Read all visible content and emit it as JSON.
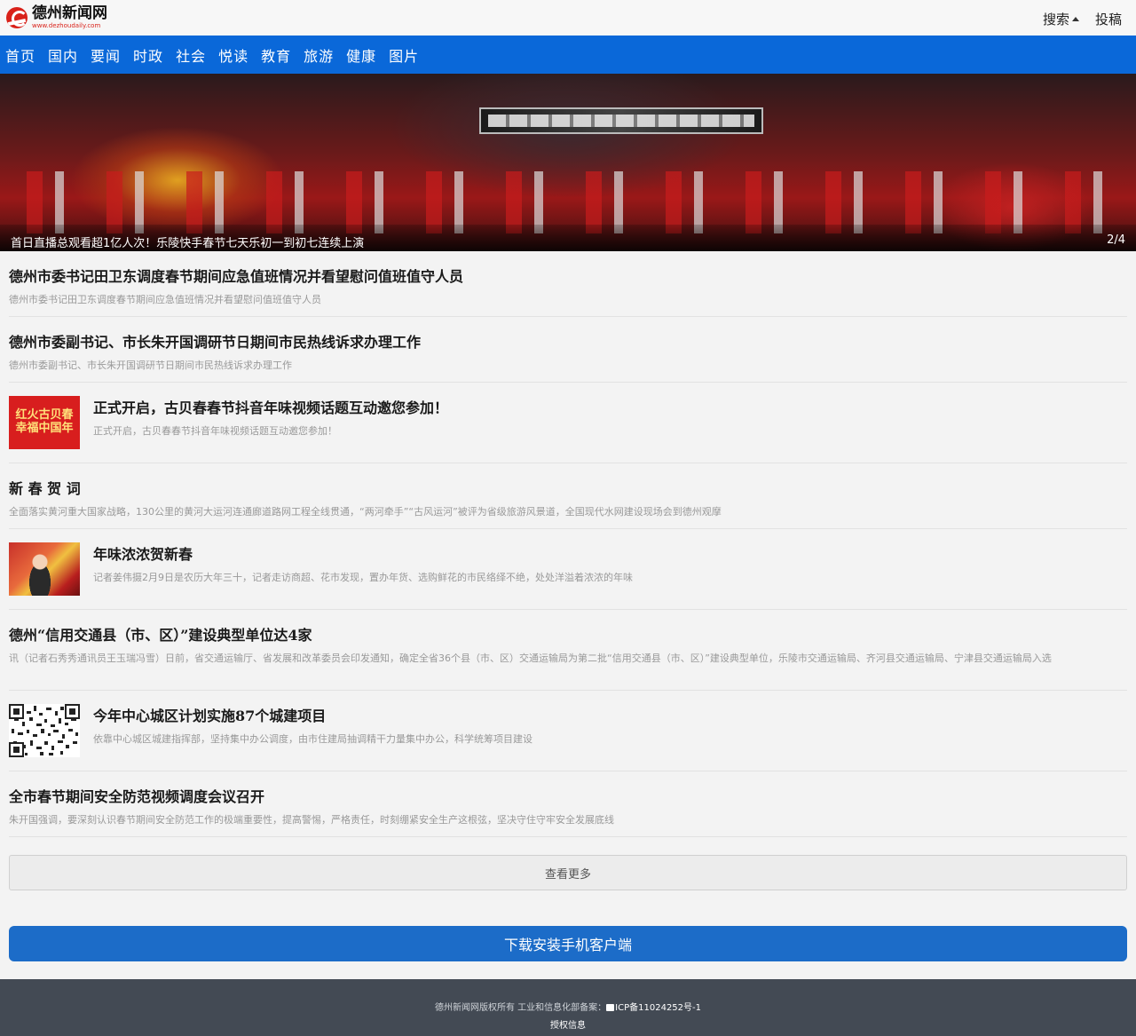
{
  "header": {
    "logo_name": "德州新闻网",
    "logo_url": "www.dezhoudaily.com",
    "search_label": "搜索",
    "submit_label": "投稿"
  },
  "nav": {
    "items": [
      "首页",
      "国内",
      "要闻",
      "时政",
      "社会",
      "悦读",
      "教育",
      "旅游",
      "健康",
      "图片"
    ]
  },
  "banner": {
    "caption": "首日直播总观看超1亿人次！乐陵快手春节七天乐初一到初七连续上演",
    "counter": "2/4"
  },
  "news": [
    {
      "title": "德州市委书记田卫东调度春节期间应急值班情况并看望慰问值班值守人员",
      "summary": "德州市委书记田卫东调度春节期间应急值班情况并看望慰问值班值守人员",
      "thumb": null
    },
    {
      "title": "德州市委副书记、市长朱开国调研节日期间市民热线诉求办理工作",
      "summary": "德州市委副书记、市长朱开国调研节日期间市民热线诉求办理工作",
      "thumb": null
    },
    {
      "title": "正式开启，古贝春春节抖音年味视频话题互动邀您参加！",
      "summary": "正式开启，古贝春春节抖音年味视频话题互动邀您参加！",
      "thumb": "red-poster",
      "thumb_text": [
        "红火古贝春",
        "幸福中国年"
      ]
    },
    {
      "title": "新 春 贺 词",
      "summary": "全面落实黄河重大国家战略，130公里的黄河大运河连通廊道路网工程全线贯通，“两河牵手”“古风运河”被评为省级旅游风景道，全国现代水网建设现场会到德州观摩",
      "thumb": null
    },
    {
      "title": "年味浓浓贺新春",
      "summary": "记者姜伟摄2月9日是农历大年三十，记者走访商超、花市发现，置办年货、选购鲜花的市民络绎不绝，处处洋溢着浓浓的年味",
      "thumb": "photo"
    },
    {
      "title": "德州“信用交通县（市、区）”建设典型单位达4家",
      "summary": "讯（记者石秀秀通讯员王玉瑞冯雪）日前，省交通运输厅、省发展和改革委员会印发通知，确定全省36个县（市、区）交通运输局为第二批“信用交通县（市、区）”建设典型单位，乐陵市交通运输局、齐河县交通运输局、宁津县交通运输局入选",
      "thumb": null
    },
    {
      "title": "今年中心城区计划实施87个城建项目",
      "summary": "依靠中心城区城建指挥部，坚持集中办公调度，由市住建局抽调精干力量集中办公，科学统筹项目建设",
      "thumb": "qr"
    },
    {
      "title": "全市春节期间安全防范视频调度会议召开",
      "summary": "朱开国强调，要深刻认识春节期间安全防范工作的极端重要性，提高警惕，严格责任，时刻绷紧安全生产这根弦，坚决守住守牢安全发展底线",
      "thumb": null
    }
  ],
  "more_label": "查看更多",
  "download_label": "下载安装手机客户端",
  "footer": {
    "copyright": "德州新闻网版权所有 工业和信息化部备案：",
    "icp": "ICP备11024252号-1",
    "license": "授权信息"
  },
  "colors": {
    "nav_blue": "#0a68d9",
    "download_blue": "#1c6cc8",
    "footer_bg": "#434a54",
    "brand_red": "#d9221a"
  }
}
